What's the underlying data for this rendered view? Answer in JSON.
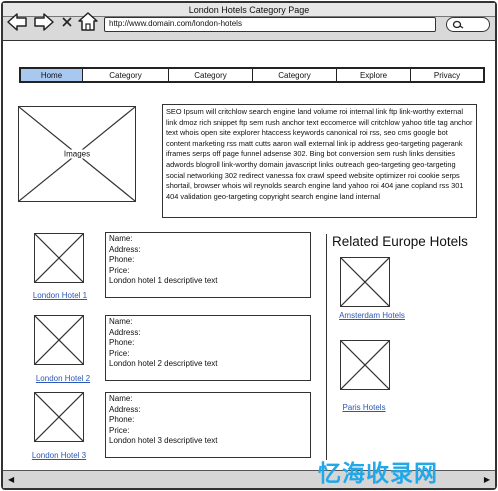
{
  "window": {
    "title": "London Hotels Category Page"
  },
  "browser": {
    "url": "http://www.domain.com/london-hotels",
    "icons": [
      "arrow-back-icon",
      "arrow-forward-icon",
      "close-icon",
      "home-icon",
      "search-icon"
    ]
  },
  "menu": {
    "items": [
      {
        "label": "Home",
        "active": true
      },
      {
        "label": "Category"
      },
      {
        "label": "Category"
      },
      {
        "label": "Category"
      },
      {
        "label": "Explore"
      },
      {
        "label": "Privacy"
      }
    ],
    "active_color": "#a9c8f0"
  },
  "hero": {
    "image_label": "Images",
    "seo_text": "SEO Ipsum will critchlow search engine land volume roi internal link ftp link-worthy external link dmoz rich snippet ftp sem rush anchor text eccomerce will critchlow yahoo title tag anchor text whois open site explorer htaccess keywords canonical roi rss, seo cms google bot content marketing rss matt cutts aaron wall external link ip address geo-targeting pagerank iframes serps off page funnel adsense 302. Bing bot conversion sem rush links densities adwords blogroll link-worthy domain javascript links outreach geo-targeting geo-targeting social networking 302 redirect vanessa fox crawl speed website optimizer roi cookie serps shortail, browser whois wil reynolds search engine land yahoo roi 404 jane copland rss 301 404 validation geo-targeting copyright search engine land internal"
  },
  "hotels": [
    {
      "link": "London Hotel 1",
      "name": "Name:",
      "address": "Address:",
      "phone": "Phone:",
      "price": "Price:",
      "desc": "London hotel 1 descriptive text"
    },
    {
      "link": "London Hotel 2",
      "name": "Name:",
      "address": "Address:",
      "phone": "Phone:",
      "price": "Price:",
      "desc": "London hotel 2 descriptive text"
    },
    {
      "link": "London Hotel 3",
      "name": "Name:",
      "address": "Address:",
      "phone": "Phone:",
      "price": "Price:",
      "desc": "London hotel 3 descriptive text"
    }
  ],
  "related": {
    "title": "Related Europe Hotels",
    "items": [
      {
        "link": "Amsterdam Hotels"
      },
      {
        "link": "Paris Hotels"
      }
    ]
  },
  "watermark": "忆海收录网",
  "colors": {
    "link": "#2a56b8",
    "watermark": "#22a8e8",
    "chrome": "#d9d9d9"
  }
}
